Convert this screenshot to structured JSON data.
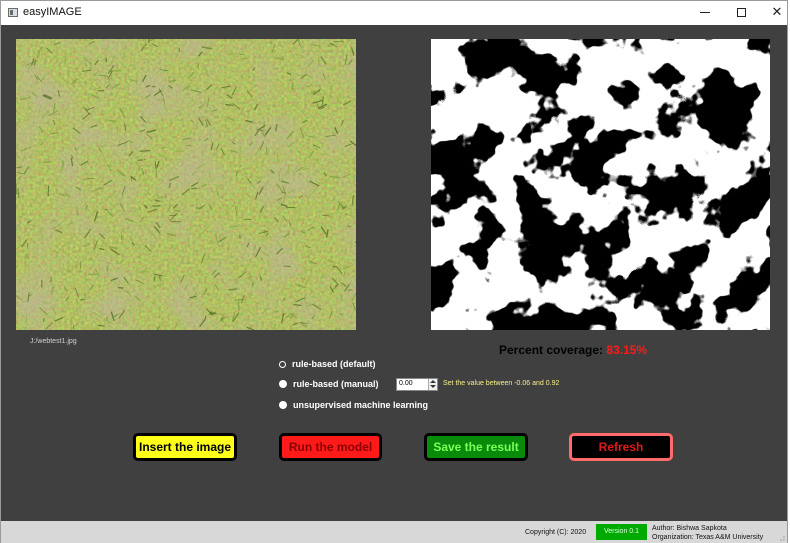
{
  "window": {
    "title": "easyIMAGE",
    "min_icon": "minimize-icon",
    "max_icon": "maximize-icon",
    "close_glyph": "✕"
  },
  "input_image": {
    "path": "J:/webtest1.jpg",
    "kind": "grass-field-photo"
  },
  "output_image": {
    "kind": "binary-segmentation-mask"
  },
  "coverage": {
    "label": "Percent coverage:",
    "value": "83.15%",
    "value_color": "#ff1a1a"
  },
  "options": {
    "selected": "rule-based (default)",
    "items": [
      {
        "label": "rule-based (default)",
        "checked": false
      },
      {
        "label": "rule-based (manual)",
        "checked": true
      },
      {
        "label": "unsupervised machine learning",
        "checked": true
      }
    ],
    "manual_value": "0.00",
    "hint": "Set the value between -0.06 and 0.92"
  },
  "buttons": {
    "insert": "Insert the image",
    "run": "Run the model",
    "save": "Save the result",
    "refresh": "Refresh"
  },
  "colors": {
    "background": "#404040",
    "insert": "#ffff1a",
    "run": "#ff1a1a",
    "save": "#0a8a0a",
    "refresh": "#000000",
    "version_badge": "#00aa00"
  },
  "status": {
    "copyright": "Copyright (C): 2020",
    "version": "Version 0.1",
    "author": "Author: Bishwa Sapkota",
    "organization": "Organization: Texas A&M University"
  }
}
